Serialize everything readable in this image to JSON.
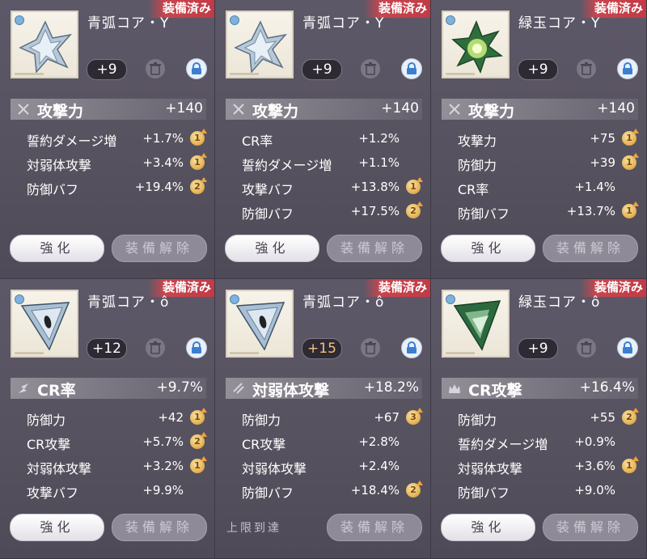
{
  "cards": [
    {
      "equipped_badge": "装備済み",
      "name": "青弧コア・Y",
      "level": "+9",
      "main": {
        "icon": "sword-icon",
        "label": "攻撃力",
        "value": "+140"
      },
      "subs": [
        {
          "label": "誓約ダメージ増",
          "value": "+1.7%",
          "roll": "1"
        },
        {
          "label": "対弱体攻撃",
          "value": "+3.4%",
          "roll": "1"
        },
        {
          "label": "防御バフ",
          "value": "+19.4%",
          "roll": "2"
        }
      ],
      "enhance_label": "強化",
      "unequip_label": "装備解除"
    },
    {
      "equipped_badge": "装備済み",
      "name": "青弧コア・Y",
      "level": "+9",
      "main": {
        "icon": "sword-icon",
        "label": "攻撃力",
        "value": "+140"
      },
      "subs": [
        {
          "label": "CR率",
          "value": "+1.2%",
          "roll": ""
        },
        {
          "label": "誓約ダメージ増",
          "value": "+1.1%",
          "roll": ""
        },
        {
          "label": "攻撃バフ",
          "value": "+13.8%",
          "roll": "1"
        },
        {
          "label": "防御バフ",
          "value": "+17.5%",
          "roll": "2"
        }
      ],
      "enhance_label": "強化",
      "unequip_label": "装備解除"
    },
    {
      "equipped_badge": "装備済み",
      "name": "緑玉コア・Y",
      "level": "+9",
      "main": {
        "icon": "sword-icon",
        "label": "攻撃力",
        "value": "+140"
      },
      "subs": [
        {
          "label": "攻撃力",
          "value": "+75",
          "roll": "1"
        },
        {
          "label": "防御力",
          "value": "+39",
          "roll": "1"
        },
        {
          "label": "CR率",
          "value": "+1.4%",
          "roll": ""
        },
        {
          "label": "防御バフ",
          "value": "+13.7%",
          "roll": "1"
        }
      ],
      "enhance_label": "強化",
      "unequip_label": "装備解除"
    },
    {
      "equipped_badge": "装備済み",
      "name": "青弧コア・ô",
      "level": "+12",
      "main": {
        "icon": "critical-rate-icon",
        "label": "CR率",
        "value": "+9.7%"
      },
      "subs": [
        {
          "label": "防御力",
          "value": "+42",
          "roll": "1"
        },
        {
          "label": "CR攻撃",
          "value": "+5.7%",
          "roll": "2"
        },
        {
          "label": "対弱体攻撃",
          "value": "+3.2%",
          "roll": "1"
        },
        {
          "label": "攻撃バフ",
          "value": "+9.9%",
          "roll": ""
        }
      ],
      "enhance_label": "強化",
      "unequip_label": "装備解除"
    },
    {
      "equipped_badge": "装備済み",
      "name": "青弧コア・ô",
      "level": "+15",
      "main": {
        "icon": "weakness-attack-icon",
        "label": "対弱体攻撃",
        "value": "+18.2%"
      },
      "subs": [
        {
          "label": "防御力",
          "value": "+67",
          "roll": "3"
        },
        {
          "label": "CR攻撃",
          "value": "+2.8%",
          "roll": ""
        },
        {
          "label": "対弱体攻撃",
          "value": "+2.4%",
          "roll": ""
        },
        {
          "label": "防御バフ",
          "value": "+18.4%",
          "roll": "2"
        }
      ],
      "maxed_label": "上限到達",
      "unequip_label": "装備解除"
    },
    {
      "equipped_badge": "装備済み",
      "name": "緑玉コア・ô",
      "level": "+9",
      "main": {
        "icon": "crown-icon",
        "label": "CR攻撃",
        "value": "+16.4%"
      },
      "subs": [
        {
          "label": "防御力",
          "value": "+55",
          "roll": "2"
        },
        {
          "label": "誓約ダメージ増",
          "value": "+0.9%",
          "roll": ""
        },
        {
          "label": "対弱体攻撃",
          "value": "+3.6%",
          "roll": "1"
        },
        {
          "label": "防御バフ",
          "value": "+9.0%",
          "roll": ""
        }
      ],
      "enhance_label": "強化",
      "unequip_label": "装備解除"
    }
  ]
}
